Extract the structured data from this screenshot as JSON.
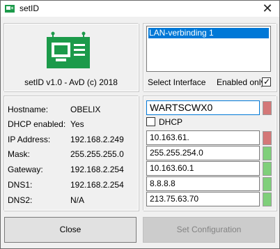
{
  "window": {
    "title": "setID",
    "close_glyph": "✕"
  },
  "app": {
    "version_text": "setID v1.0 - AvD (c) 2018",
    "logo_icon": "monitor-board-icon",
    "brand_color": "#1c9a4a"
  },
  "interface": {
    "items": [
      "LAN-verbinding 1"
    ],
    "select_label": "Select Interface",
    "enabled_only_label": "Enabled only",
    "enabled_only_checked": true
  },
  "info": {
    "rows": [
      {
        "label": "Hostname:",
        "value": "OBELIX"
      },
      {
        "label": "DHCP enabled:",
        "value": "Yes"
      },
      {
        "label": "IP Address:",
        "value": "192.168.2.249"
      },
      {
        "label": "Mask:",
        "value": "255.255.255.0"
      },
      {
        "label": "Gateway:",
        "value": "192.168.2.254"
      },
      {
        "label": "DNS1:",
        "value": "192.168.2.254"
      },
      {
        "label": "DNS2:",
        "value": "N/A"
      }
    ]
  },
  "fields": {
    "hostname": "WARTSCWX0",
    "dhcp_label": "DHCP",
    "dhcp_checked": false,
    "ip": "10.163.61.",
    "mask": "255.255.254.0",
    "gateway": "10.163.60.1",
    "dns1": "8.8.8.8",
    "dns2": "213.75.63.70"
  },
  "indicators": {
    "hostname": "#d47878",
    "ip": "#d47878",
    "mask": "#7fcf7a",
    "gateway": "#7fcf7a",
    "dns1": "#7fcf7a",
    "dns2": "#7fcf7a"
  },
  "buttons": {
    "close": "Close",
    "set_configuration": "Set Configuration"
  }
}
